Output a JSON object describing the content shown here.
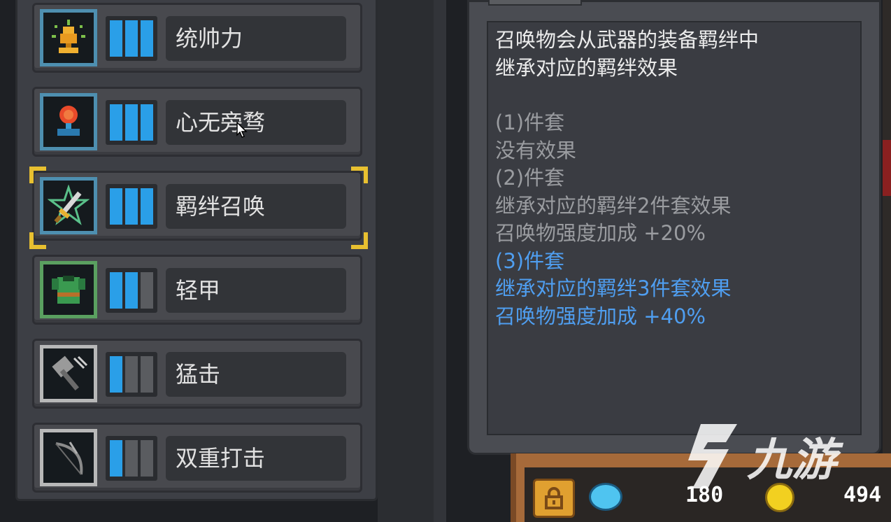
{
  "skills": [
    {
      "name": "统帅力",
      "icon": "trophy-icon",
      "level": 3,
      "max": 3,
      "tier": "blue"
    },
    {
      "name": "心无旁骛",
      "icon": "medal-icon",
      "level": 3,
      "max": 3,
      "tier": "blue"
    },
    {
      "name": "羁绊召唤",
      "icon": "sword-star-icon",
      "level": 3,
      "max": 3,
      "tier": "blue",
      "selected": true
    },
    {
      "name": "轻甲",
      "icon": "armor-icon",
      "level": 2,
      "max": 3,
      "tier": "green"
    },
    {
      "name": "猛击",
      "icon": "hammer-icon",
      "level": 1,
      "max": 3,
      "tier": "white"
    },
    {
      "name": "双重打击",
      "icon": "bow-icon",
      "level": 1,
      "max": 3,
      "tier": "white"
    }
  ],
  "description": {
    "intro": [
      "召唤物会从武器的装备羁绊中",
      "继承对应的羁绊效果"
    ],
    "sets": [
      {
        "title": "(1)件套",
        "lines": [
          "没有效果"
        ],
        "active": false
      },
      {
        "title": "(2)件套",
        "lines": [
          "继承对应的羁绊2件套效果",
          "召唤物强度加成 +20%"
        ],
        "active": false
      },
      {
        "title": "(3)件套",
        "lines": [
          "继承对应的羁绊3件套效果",
          "召唤物强度加成 +40%"
        ],
        "active": true
      }
    ]
  },
  "currency": {
    "gems": "180",
    "gold": "494"
  },
  "watermark": {
    "text": "九游"
  },
  "colors": {
    "accent_blue": "#2a9fe8",
    "active_text": "#4f9ef0",
    "selection_corner": "#e8c030"
  }
}
